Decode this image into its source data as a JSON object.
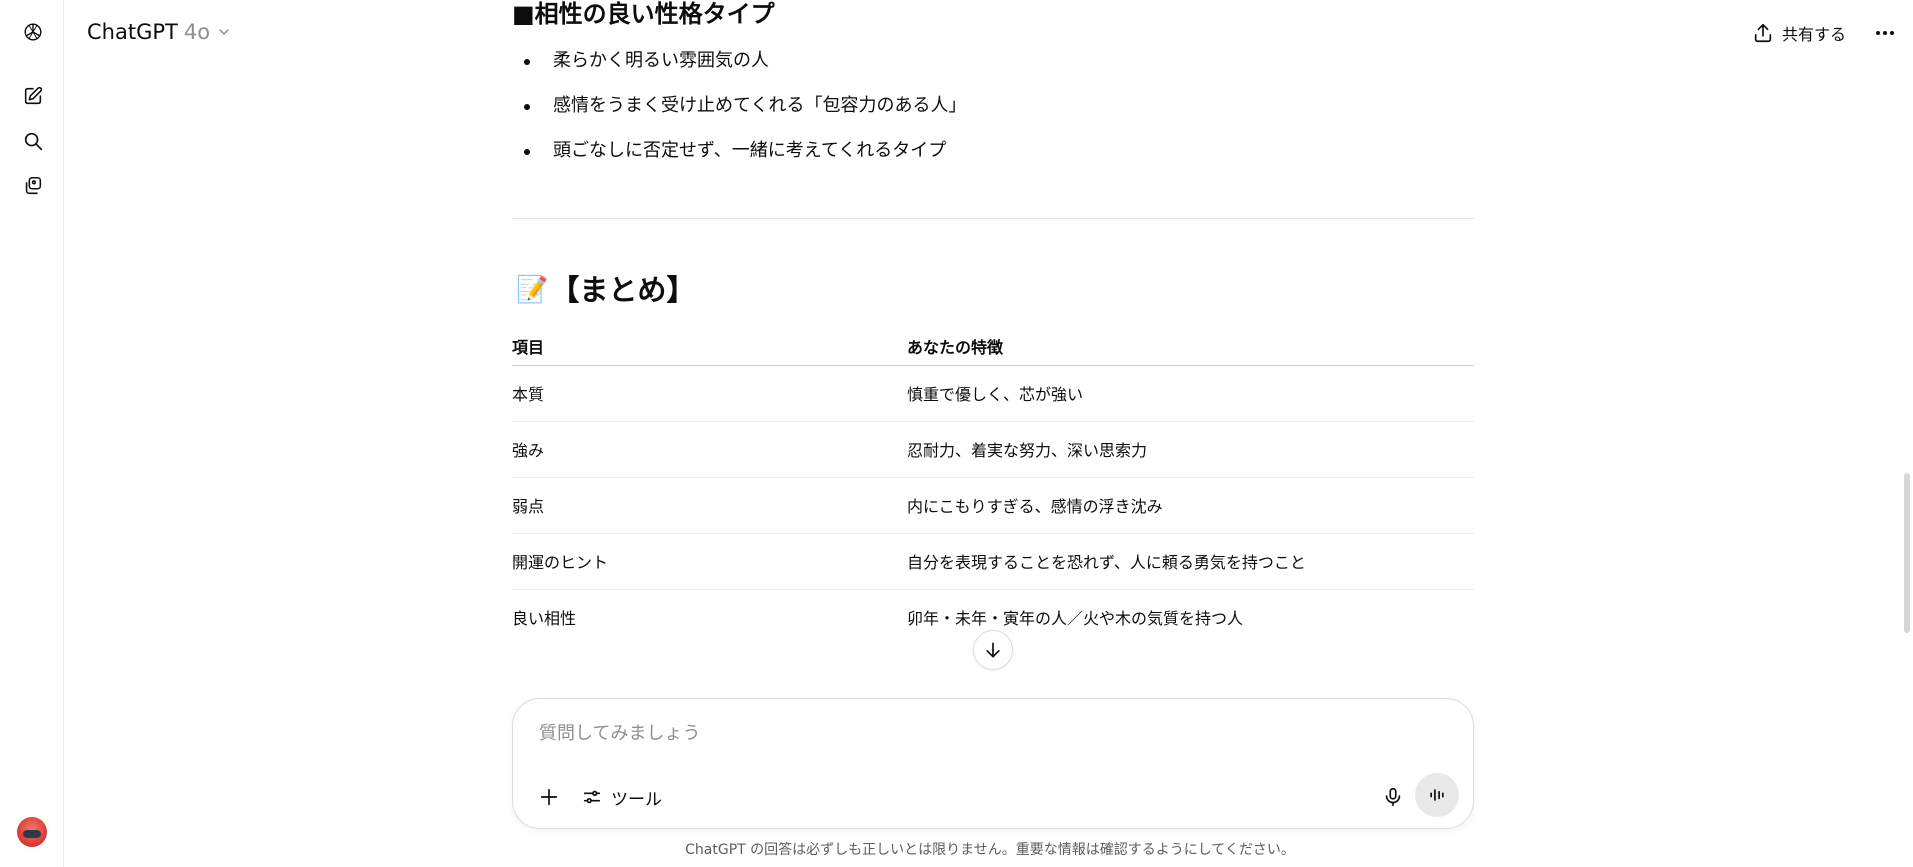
{
  "header": {
    "title": "ChatGPT",
    "model": "4o",
    "share_label": "共有する"
  },
  "rail": {
    "icons": [
      "openai-logo-icon",
      "new-chat-icon",
      "search-icon",
      "library-icon",
      "avatar"
    ]
  },
  "message": {
    "section_heading": "■相性の良い性格タイプ",
    "bullets": [
      "柔らかく明るい雰囲気の人",
      "感情をうまく受け止めてくれる「包容力のある人」",
      "頭ごなしに否定せず、一緒に考えてくれるタイプ"
    ],
    "summary_emoji": "📝",
    "summary_title": "【まとめ】",
    "table": {
      "headers": [
        "項目",
        "あなたの特徴"
      ],
      "rows": [
        [
          "本質",
          "慎重で優しく、芯が強い"
        ],
        [
          "強み",
          "忍耐力、着実な努力、深い思索力"
        ],
        [
          "弱点",
          "内にこもりすぎる、感情の浮き沈み"
        ],
        [
          "開運のヒント",
          "自分を表現することを恐れず、人に頼る勇気を持つこと"
        ],
        [
          "良い相性",
          "卯年・未年・寅年の人／火や木の気質を持つ人"
        ]
      ]
    }
  },
  "composer": {
    "placeholder": "質問してみましょう",
    "value": "",
    "tools_label": "ツール"
  },
  "footer": {
    "disclaimer": "ChatGPT の回答は必ずしも正しいとは限りません。重要な情報は確認するようにしてください。"
  }
}
